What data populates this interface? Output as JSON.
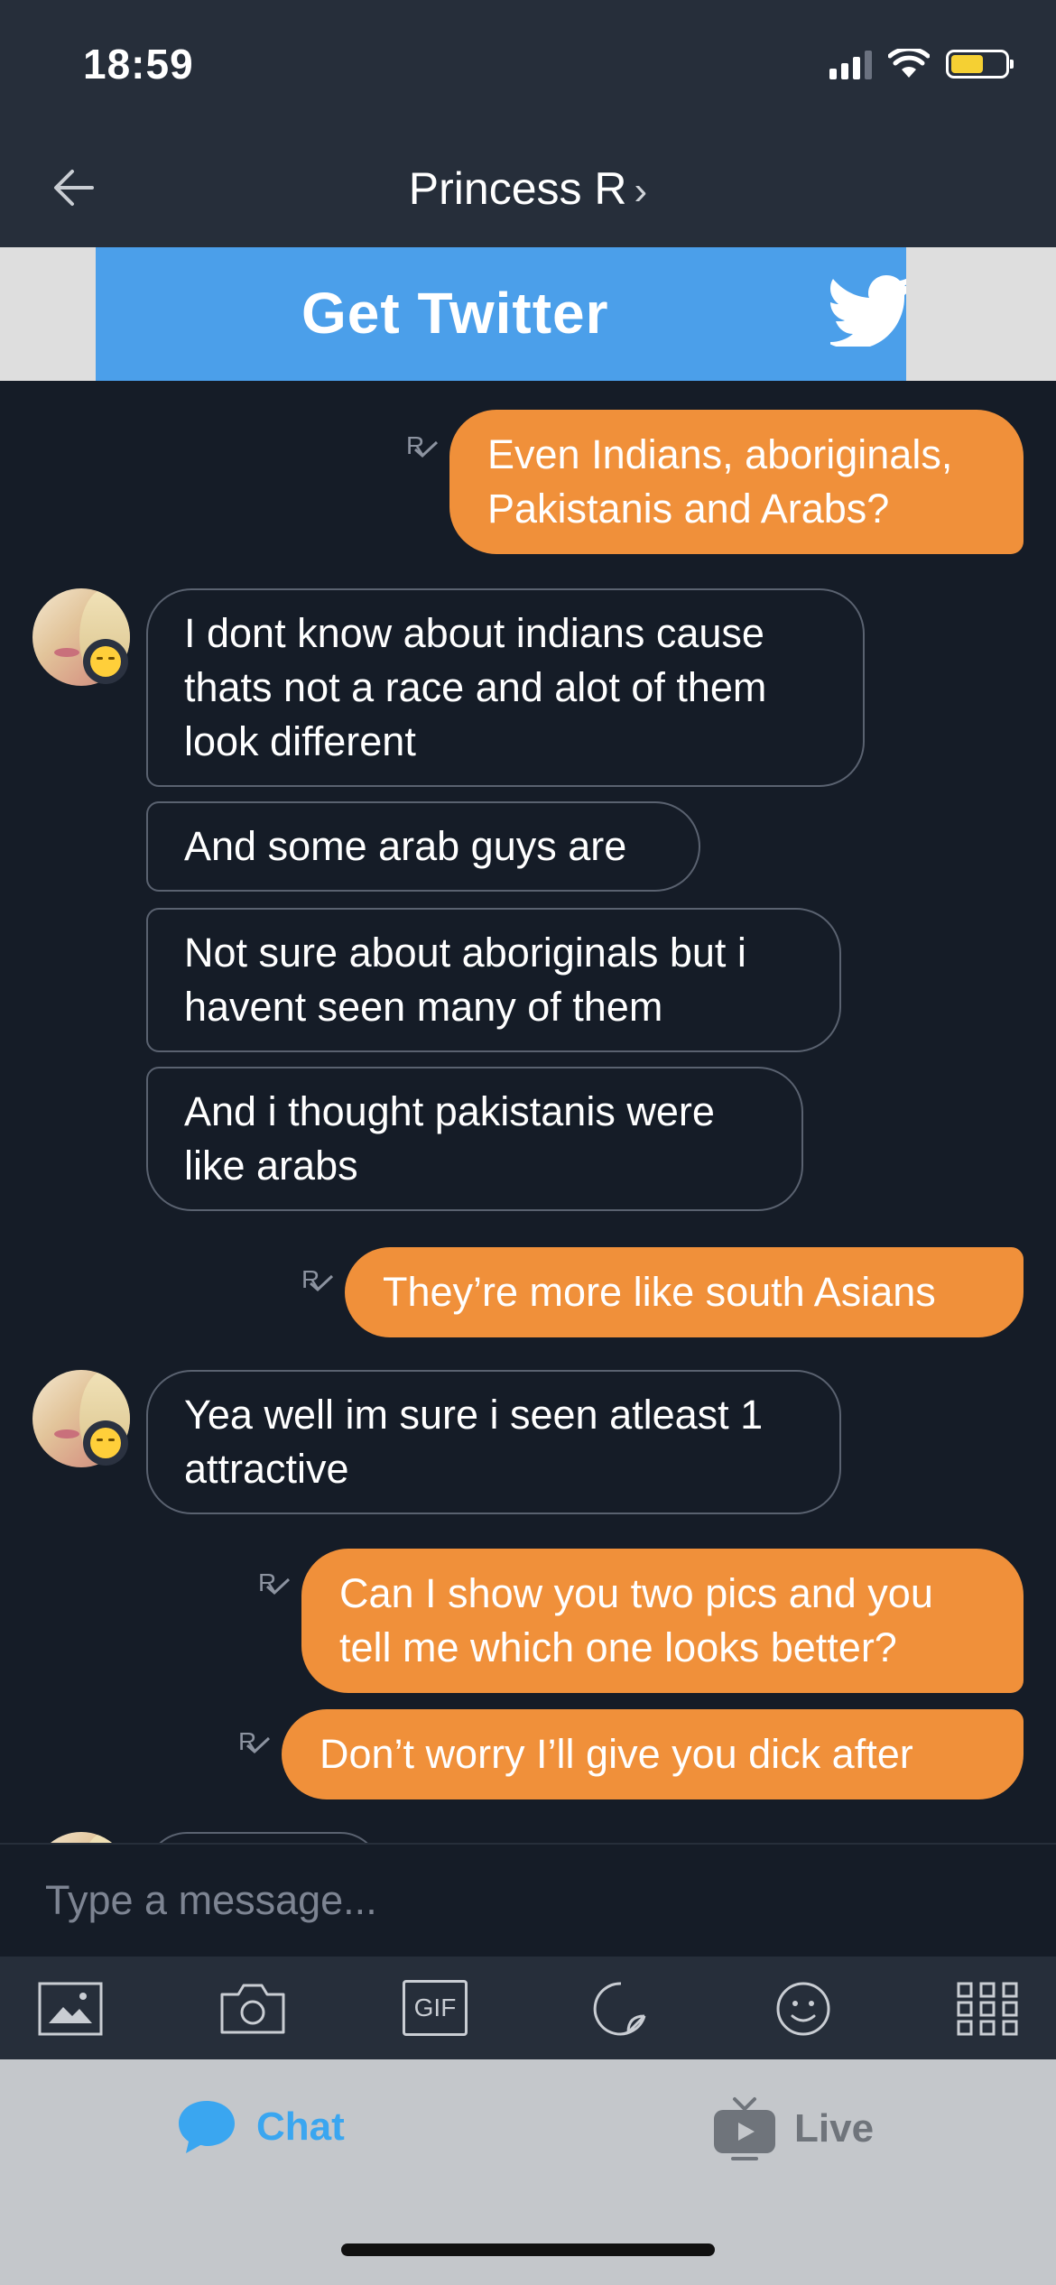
{
  "status_bar": {
    "time": "18:59",
    "battery_level": 0.6,
    "battery_color": "#f5d033"
  },
  "header": {
    "title": "Princess R",
    "chevron": "›",
    "back_icon": "arrow-left-icon"
  },
  "ad": {
    "text": "Get Twitter",
    "color": "#4b9fea",
    "icon": "twitter-bird-icon"
  },
  "messages": [
    {
      "direction": "outgoing",
      "read_mark": "R",
      "text_lines": [
        "Even Indians, aboriginals,",
        "Pakistanis and Arabs?"
      ]
    },
    {
      "direction": "incoming",
      "text_lines": [
        "I dont know about indians cause",
        "thats not a race and alot of them",
        "look different"
      ]
    },
    {
      "direction": "incoming",
      "text_lines": [
        "And some arab guys are"
      ]
    },
    {
      "direction": "incoming",
      "text_lines": [
        "Not sure about aboriginals but i",
        "havent seen many of them"
      ]
    },
    {
      "direction": "incoming",
      "text_lines": [
        "And i thought pakistanis were",
        "like arabs"
      ]
    },
    {
      "direction": "outgoing",
      "read_mark": "R",
      "text_lines": [
        "They’re more like south Asians"
      ]
    },
    {
      "direction": "incoming",
      "text_lines": [
        "Yea well im sure i seen atleast 1",
        "attractive"
      ]
    },
    {
      "direction": "outgoing",
      "read_mark": "R",
      "text_lines": [
        "Can I show you two pics and you",
        "tell me which one looks better?"
      ]
    },
    {
      "direction": "outgoing",
      "read_mark": "R",
      "text_lines": [
        "Don’t worry I’ll give you dick after"
      ]
    }
  ],
  "composer": {
    "placeholder": "Type a message..."
  },
  "toolbar": {
    "gif_label": "GIF",
    "icons": [
      "image-icon",
      "camera-icon",
      "gif-icon",
      "sticker-icon",
      "emoji-icon",
      "grid-icon"
    ]
  },
  "tabs": {
    "chat_label": "Chat",
    "live_label": "Live",
    "chat_color": "#3aa6f0"
  },
  "colors": {
    "outgoing_bubble": "#f0903a",
    "background": "#151c27",
    "header": "#262e3a"
  }
}
